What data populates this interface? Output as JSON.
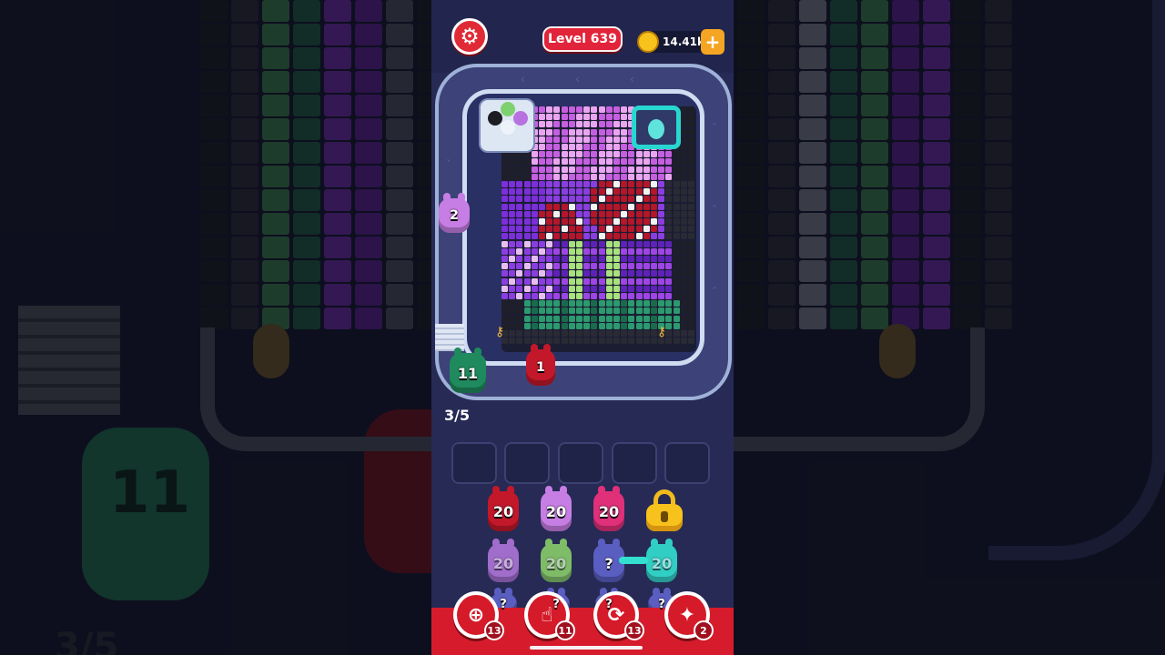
{
  "header": {
    "settings_icon": "gear-icon",
    "level_label": "Level 639",
    "coins": "14.41k",
    "add_coins_icon": "plus-icon"
  },
  "board": {
    "left_queue": [
      {
        "value": "2",
        "color": "#c77ee4"
      }
    ],
    "conveyor": [
      {
        "value": "11",
        "color": "#1f8a5d"
      },
      {
        "value": "1",
        "color": "#c3182a"
      }
    ],
    "progress": "3/5",
    "keys": [
      "key-icon",
      "key-icon"
    ]
  },
  "slots_count": 5,
  "pieces": {
    "row1": [
      {
        "value": "20",
        "color": "#c3182a"
      },
      {
        "value": "20",
        "color": "#c77ee4"
      },
      {
        "value": "20",
        "color": "#e0307a"
      }
    ],
    "row2": [
      {
        "value": "20",
        "color": "#b779e0"
      },
      {
        "value": "20",
        "color": "#8fd66c"
      },
      {
        "value": "?",
        "color": "#5a5ec0"
      },
      {
        "value": "20",
        "color": "#33e0d0"
      }
    ],
    "row3": [
      {
        "value": "?",
        "color": "#5a5ec0"
      },
      {
        "value": "?",
        "color": "#5a5ec0"
      },
      {
        "value": "?",
        "color": "#5a5ec0"
      },
      {
        "value": "?",
        "color": "#5a5ec0"
      }
    ]
  },
  "powerups": [
    {
      "icon": "add-slot-icon",
      "count": "13"
    },
    {
      "icon": "hand-pick-icon",
      "count": "11"
    },
    {
      "icon": "shuffle-icon",
      "count": "13"
    },
    {
      "icon": "ghost-magnet-icon",
      "count": "2"
    }
  ],
  "colors": {
    "accent_red": "#d61c2c",
    "panel": "#262a55",
    "track_border": "#9fb1d8",
    "coin_gold": "#f8c21c"
  }
}
